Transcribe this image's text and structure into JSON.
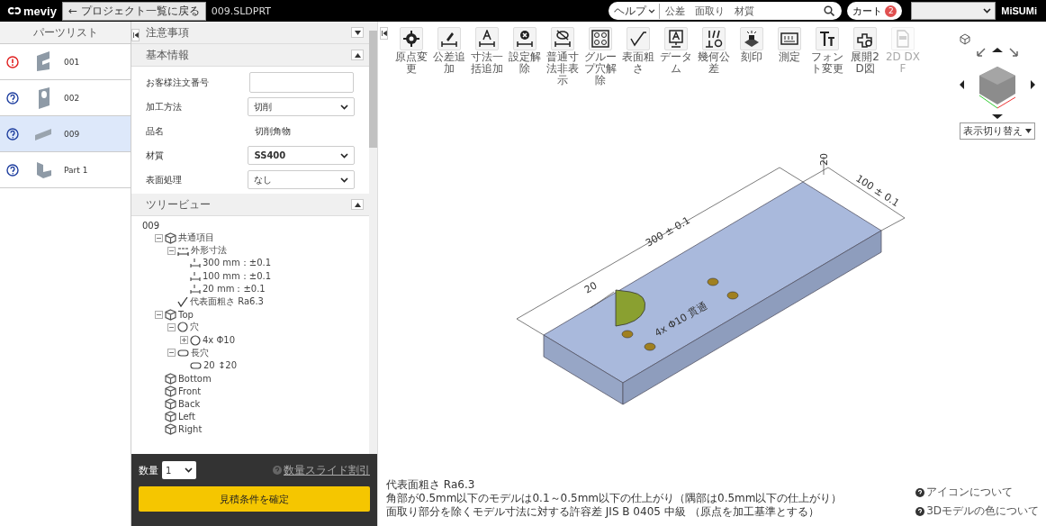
{
  "header": {
    "logo": "meviy",
    "back_button": "← プロジェクト一覧に戻る",
    "file_name": "009.SLDPRT",
    "help_menu": "ヘルプ",
    "search": {
      "placeholder": "公差　面取り　材質"
    },
    "cart": {
      "label": "カート",
      "count": "2"
    },
    "brand": "MiSUMi"
  },
  "parts_list": {
    "title": "パーツリスト",
    "items": [
      {
        "name": "001",
        "error": true,
        "selected": false
      },
      {
        "name": "002",
        "error": false,
        "selected": false
      },
      {
        "name": "009",
        "error": false,
        "selected": true
      },
      {
        "name": "Part 1",
        "error": false,
        "selected": false
      }
    ]
  },
  "sections": [
    {
      "title": "注意事項",
      "expanded": false
    },
    {
      "title": "基本情報",
      "expanded": true
    }
  ],
  "basic_info": [
    {
      "kind": "input",
      "label": "お客様注文番号"
    },
    {
      "kind": "select",
      "label": "加工方法",
      "value": "切削"
    },
    {
      "kind": "text",
      "label": "品名",
      "value": "切削角物"
    },
    {
      "kind": "select",
      "label": "材質",
      "value": "SS400"
    },
    {
      "kind": "select",
      "label": "表面処理",
      "value": "なし"
    }
  ],
  "tree_view": {
    "title": "ツリービュー",
    "expanded": true,
    "root": "009",
    "nodes": [
      {
        "kind": "face",
        "label": "共通項目",
        "expanded": true,
        "children": [
          {
            "kind": "dims",
            "label": "外形寸法",
            "expanded": true,
            "children": [
              {
                "kind": "dim-x",
                "label": "300 mm：±0.1"
              },
              {
                "kind": "dim-y",
                "label": "100 mm：±0.1"
              },
              {
                "kind": "dim-z",
                "label": "20 mm：±0.1"
              }
            ]
          },
          {
            "kind": "roughness",
            "label": "代表面粗さ Ra6.3"
          }
        ]
      },
      {
        "kind": "face",
        "label": "Top",
        "expanded": true,
        "children": [
          {
            "kind": "hole",
            "label": "穴",
            "expanded": true,
            "children": [
              {
                "kind": "hole",
                "label": "4x Φ10",
                "expanded": false
              }
            ]
          },
          {
            "kind": "slot",
            "label": "長穴",
            "expanded": true,
            "children": [
              {
                "kind": "slot",
                "label": "20 ↕20"
              }
            ]
          }
        ]
      },
      {
        "kind": "face",
        "label": "Bottom"
      },
      {
        "kind": "face",
        "label": "Front"
      },
      {
        "kind": "face",
        "label": "Back"
      },
      {
        "kind": "face",
        "label": "Left"
      },
      {
        "kind": "face",
        "label": "Right"
      }
    ]
  },
  "order": {
    "quantity_label": "数量",
    "quantity": "1",
    "discount_link": "数量スライド割引",
    "confirm_button": "見積条件を確定"
  },
  "toolbar": [
    {
      "kind": "origin",
      "label": "原点変更",
      "disabled": false
    },
    {
      "kind": "tolerance",
      "label": "公差追加",
      "disabled": false
    },
    {
      "kind": "dimension",
      "label": "寸法一括追加",
      "disabled": false
    },
    {
      "kind": "clear",
      "label": "設定解除",
      "disabled": false
    },
    {
      "kind": "hide",
      "label": "普通寸法非表示",
      "disabled": false
    },
    {
      "kind": "group",
      "label": "グループ穴解除",
      "disabled": false
    },
    {
      "kind": "roughness",
      "label": "表面粗さ",
      "disabled": false
    },
    {
      "kind": "datum",
      "label": "データム",
      "disabled": false
    },
    {
      "kind": "geometric",
      "label": "幾何公差",
      "disabled": false
    },
    {
      "kind": "stamp",
      "label": "刻印",
      "disabled": false
    },
    {
      "kind": "measure",
      "label": "測定",
      "disabled": false
    },
    {
      "kind": "font",
      "label": "フォント変更",
      "disabled": false
    },
    {
      "kind": "unfold",
      "label": "展開2D図",
      "disabled": false
    },
    {
      "kind": "dxf",
      "label": "2D DXF",
      "disabled": true
    }
  ],
  "view_switch": "表示切り替え",
  "model": {
    "length": "300 ± 0.1",
    "width": "100 ± 0.1",
    "thickness": "20",
    "slot": "20",
    "holes": "4x Φ10 貫通"
  },
  "notes": [
    "代表面粗さ Ra6.3",
    "角部が0.5mm以下のモデルは0.1～0.5mm以下の仕上がり（隅部は0.5mm以下の仕上がり）",
    "面取り部分を除くモデル寸法に対する許容差 JIS B 0405 中級 （原点を加工基準とする）"
  ],
  "help_links": [
    "アイコンについて",
    "3Dモデルの色について"
  ]
}
